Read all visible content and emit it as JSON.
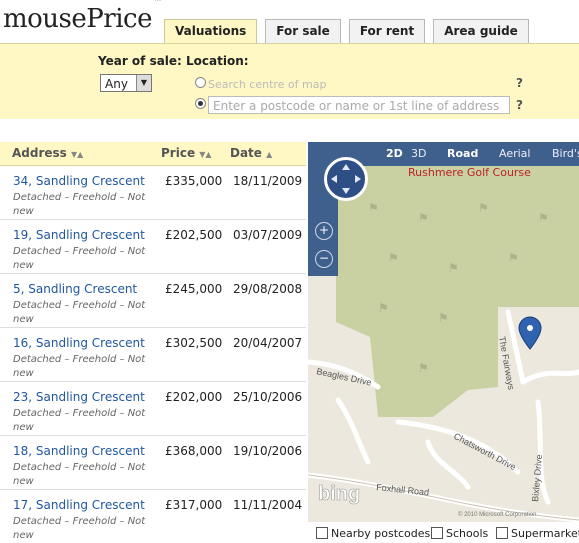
{
  "brand": {
    "name": "mousePrice",
    "tm": "™"
  },
  "tabs": [
    {
      "label": "Valuations",
      "active": true
    },
    {
      "label": "For sale"
    },
    {
      "label": "For rent"
    },
    {
      "label": "Area guide"
    }
  ],
  "search": {
    "year_label": "Year of sale:",
    "year_value": "Any",
    "location_label": "Location:",
    "map_option_label": "Search centre of map",
    "address_placeholder": "Enter a postcode or name or 1st line of address",
    "help": "?"
  },
  "table": {
    "headers": {
      "address": "Address",
      "price": "Price",
      "date": "Date"
    },
    "rows": [
      {
        "address": "34, Sandling Crescent",
        "desc": "Detached – Freehold – Not new",
        "price": "£335,000",
        "date": "18/11/2009"
      },
      {
        "address": "19, Sandling Crescent",
        "desc": "Detached – Freehold – Not new",
        "price": "£202,500",
        "date": "03/07/2009"
      },
      {
        "address": "5, Sandling Crescent",
        "desc": "Detached – Freehold – Not new",
        "price": "£245,000",
        "date": "29/08/2008"
      },
      {
        "address": "16, Sandling Crescent",
        "desc": "Detached – Freehold – Not new",
        "price": "£302,500",
        "date": "20/04/2007"
      },
      {
        "address": "23, Sandling Crescent",
        "desc": "Detached – Freehold – Not new",
        "price": "£202,000",
        "date": "25/10/2006"
      },
      {
        "address": "18, Sandling Crescent",
        "desc": "Detached – Freehold – Not new",
        "price": "£368,000",
        "date": "19/10/2006"
      },
      {
        "address": "17, Sandling Crescent",
        "desc": "Detached – Freehold – Not new",
        "price": "£317,000",
        "date": "11/11/2004"
      }
    ]
  },
  "map": {
    "modes": [
      "2D",
      "3D",
      "Road",
      "Aerial",
      "Bird's"
    ],
    "place_labels": {
      "golf": "Rushmere Golf Course",
      "beagles": "Beagles Drive",
      "fairways": "The Fairways",
      "chatsworth": "Chatsworth Drive",
      "foxhall": "Foxhall Road",
      "bixley": "Bixley Drive",
      "copyright": "© 2010 Microsoft Corporation",
      "bing": "bing"
    }
  },
  "footer": {
    "nearby": "Nearby postcodes",
    "schools": "Schools",
    "supermarkets": "Supermarkets"
  },
  "colors": {
    "accent_bg": "#fff8c4",
    "link": "#1f57a0",
    "map_bar": "#3f5f8c",
    "golf": "#c9d1a3"
  }
}
